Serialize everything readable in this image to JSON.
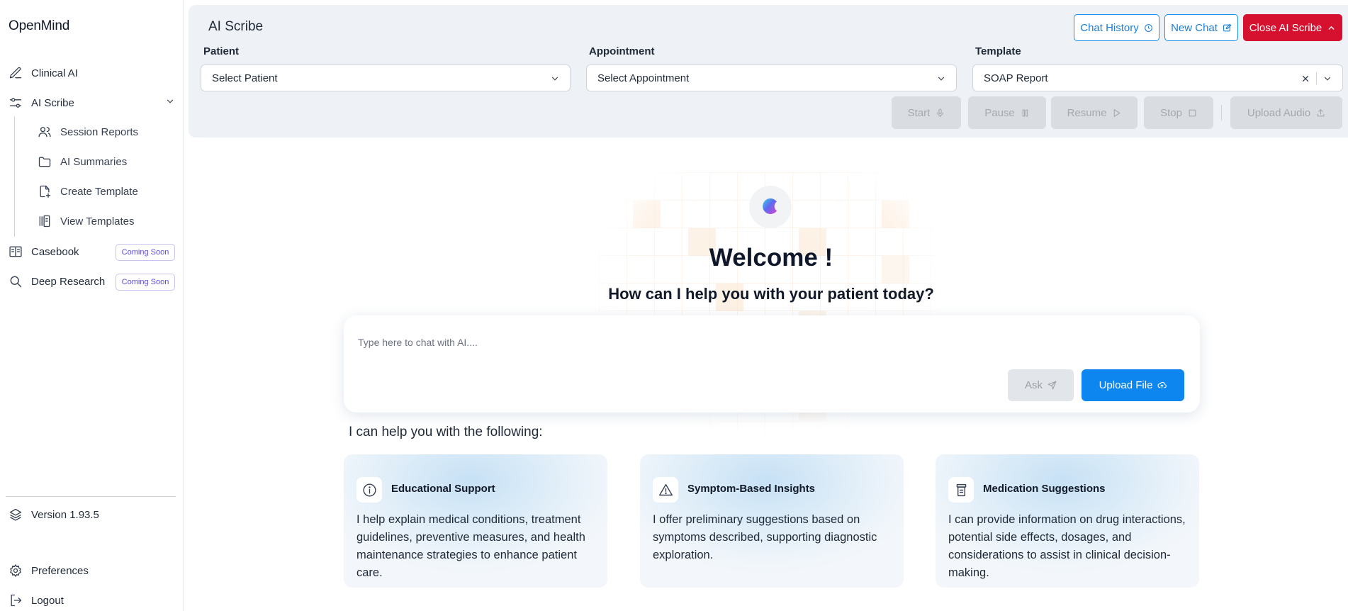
{
  "app": {
    "logo": "OpenMind"
  },
  "sidebar": {
    "items": [
      {
        "label": "Clinical AI",
        "icon": "pen-icon"
      },
      {
        "label": "AI Scribe",
        "icon": "sliders-icon",
        "expanded": true
      },
      {
        "label": "Casebook",
        "icon": "book-icon",
        "badge": "Coming Soon"
      },
      {
        "label": "Deep Research",
        "icon": "search-icon",
        "badge": "Coming Soon"
      }
    ],
    "sub_items": [
      {
        "label": "Session Reports",
        "icon": "users-icon"
      },
      {
        "label": "AI Summaries",
        "icon": "folder-icon"
      },
      {
        "label": "Create Template",
        "icon": "file-plus-icon"
      },
      {
        "label": "View Templates",
        "icon": "library-icon"
      }
    ],
    "version": "Version 1.93.5",
    "preferences": "Preferences",
    "logout": "Logout"
  },
  "header": {
    "title": "AI Scribe",
    "chat_history": "Chat History",
    "new_chat": "New Chat",
    "close": "Close AI Scribe",
    "patient_label": "Patient",
    "patient_value": "Select Patient",
    "appointment_label": "Appointment",
    "appointment_value": "Select Appointment",
    "template_label": "Template",
    "template_value": "SOAP Report",
    "controls": {
      "start": "Start",
      "pause": "Pause",
      "resume": "Resume",
      "stop": "Stop",
      "upload_audio": "Upload Audio"
    }
  },
  "main": {
    "welcome": "Welcome !",
    "tagline": "How can I help you with your patient today?",
    "chat_placeholder": "Type here to chat with AI....",
    "ask": "Ask",
    "upload_file": "Upload File",
    "help_heading": "I can help you with the following:",
    "cards": [
      {
        "title": "Educational Support",
        "icon": "info-icon",
        "desc": "I help explain medical conditions, treatment guidelines, preventive measures, and health maintenance strategies to enhance patient care."
      },
      {
        "title": "Symptom-Based Insights",
        "icon": "warning-icon",
        "desc": "I offer preliminary suggestions based on symptoms described, supporting diagnostic exploration."
      },
      {
        "title": "Medication Suggestions",
        "icon": "pill-bottle-icon",
        "desc": "I can provide information on drug interactions, potential side effects, dosages, and considerations to assist in clinical decision-making."
      }
    ]
  },
  "colors": {
    "accent": "#0e86f0",
    "danger": "#d6112f",
    "badge": "#5b4fd6",
    "panel": "#eef2f6"
  }
}
